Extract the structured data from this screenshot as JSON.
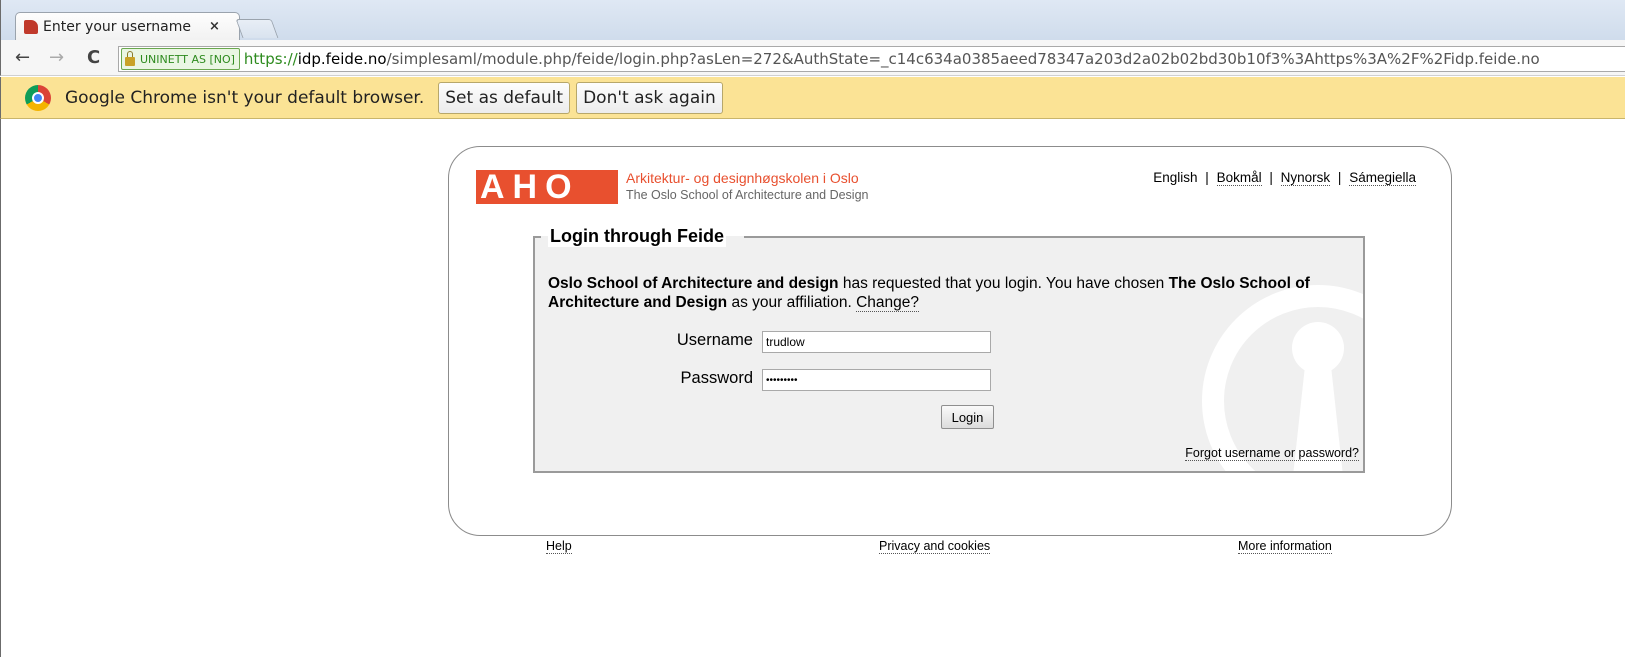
{
  "browser": {
    "tab": {
      "title": "Enter your username",
      "close_glyph": "×"
    },
    "nav": {
      "back": "←",
      "forward": "→",
      "reload": "C"
    },
    "address": {
      "ev_label": "UNINETT AS [NO]",
      "scheme": "https://",
      "host": "idp.feide.no",
      "path": "/simplesaml/module.php/feide/login.php?asLen=272&AuthState=_c14c634a0385aeed78347a203d2a02b02bd30b10f3%3Ahttps%3A%2F%2Fidp.feide.no"
    },
    "infobar": {
      "message": "Google Chrome isn't your default browser.",
      "set_default": "Set as default",
      "dont_ask": "Don't ask again"
    }
  },
  "page": {
    "logo": {
      "mark": "AHO",
      "line1": "Arkitektur- og designhøgskolen i Oslo",
      "line2": "The Oslo School of Architecture and Design"
    },
    "languages": {
      "english": "English",
      "bokmal": "Bokmål",
      "nynorsk": "Nynorsk",
      "samegiella": "Sámegiella",
      "separator": "|"
    },
    "login": {
      "legend": "Login through Feide",
      "intro_org": "Oslo School of Architecture and design",
      "intro_mid": " has requested that you login. You have chosen ",
      "intro_aff": "The Oslo School of Architecture and Design",
      "intro_end": " as your affiliation. ",
      "change_link": "Change?",
      "username_label": "Username",
      "username_value": "trudlow",
      "password_label": "Password",
      "password_value": "•••••••••",
      "login_button": "Login",
      "forgot_link": "Forgot username or password?"
    },
    "footer": {
      "help": "Help",
      "privacy": "Privacy and cookies",
      "more": "More information"
    }
  }
}
